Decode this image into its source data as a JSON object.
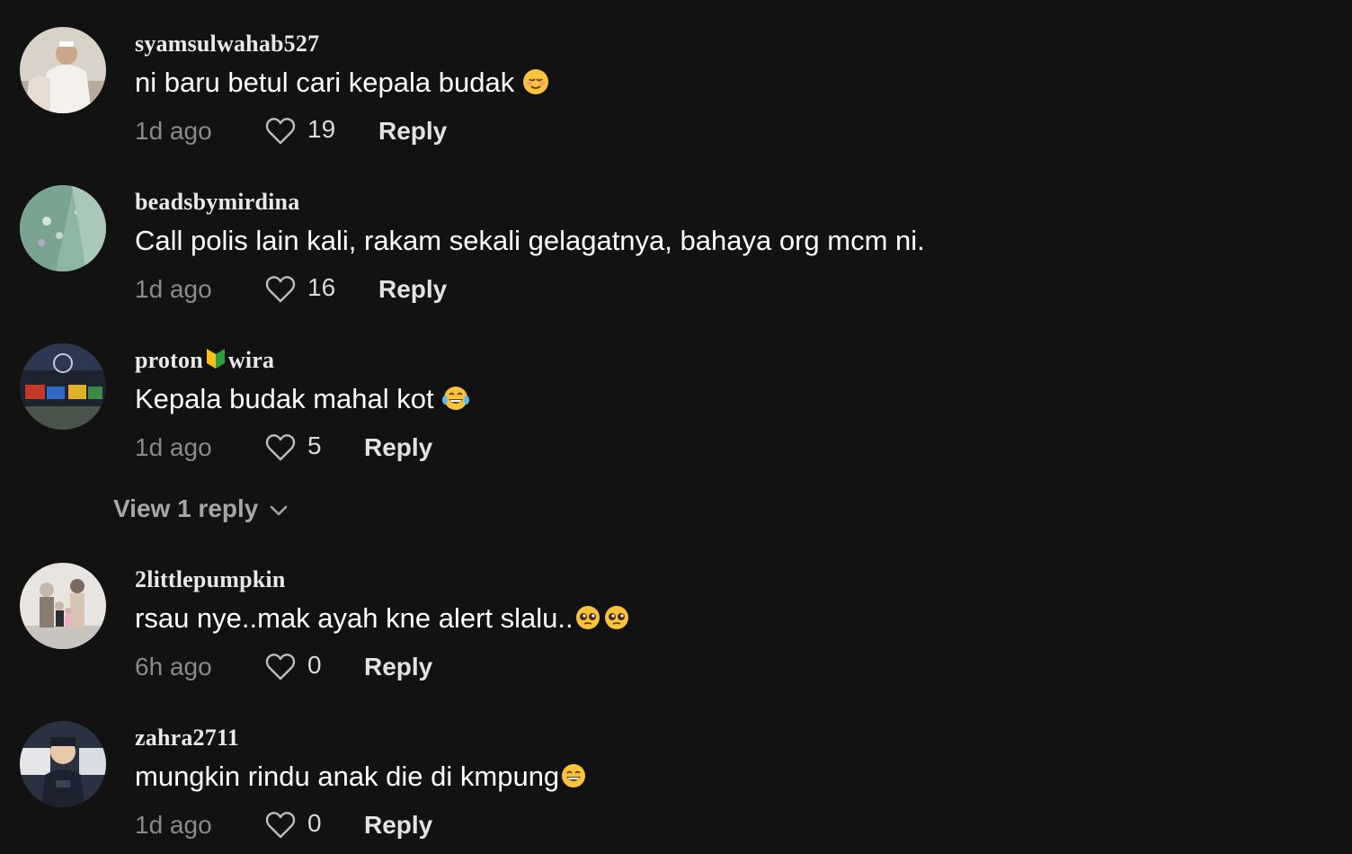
{
  "comments": [
    {
      "username": "syamsulwahab527",
      "text": "ni baru betul cari kepala budak",
      "emoji": "relieved-face",
      "time": "1d ago",
      "likes": "19",
      "reply_label": "Reply"
    },
    {
      "username": "beadsbymirdina",
      "text": "Call polis lain kali, rakam sekali gelagatnya, bahaya org mcm ni.",
      "time": "1d ago",
      "likes": "16",
      "reply_label": "Reply"
    },
    {
      "username_part1": "proton",
      "username_part2": "wira",
      "username_emoji": "japanese-beginner-symbol",
      "text": "Kepala budak mahal kot",
      "emoji": "face-with-tears-of-joy",
      "time": "1d ago",
      "likes": "5",
      "reply_label": "Reply"
    },
    {
      "username": "2littlepumpkin",
      "text": "rsau nye..mak ayah kne alert slalu..",
      "emoji": "pleading-face",
      "time": "6h ago",
      "likes": "0",
      "reply_label": "Reply"
    },
    {
      "username": "zahra2711",
      "text": "mungkin rindu anak die di kmpung",
      "emoji": "grinning-face",
      "time": "1d ago",
      "likes": "0",
      "reply_label": "Reply"
    }
  ],
  "view_replies_label": "View 1 reply",
  "colors": {
    "background": "#121212",
    "text": "#ffffff",
    "muted": "#8a8a8a",
    "reply": "#e3e3e3"
  }
}
